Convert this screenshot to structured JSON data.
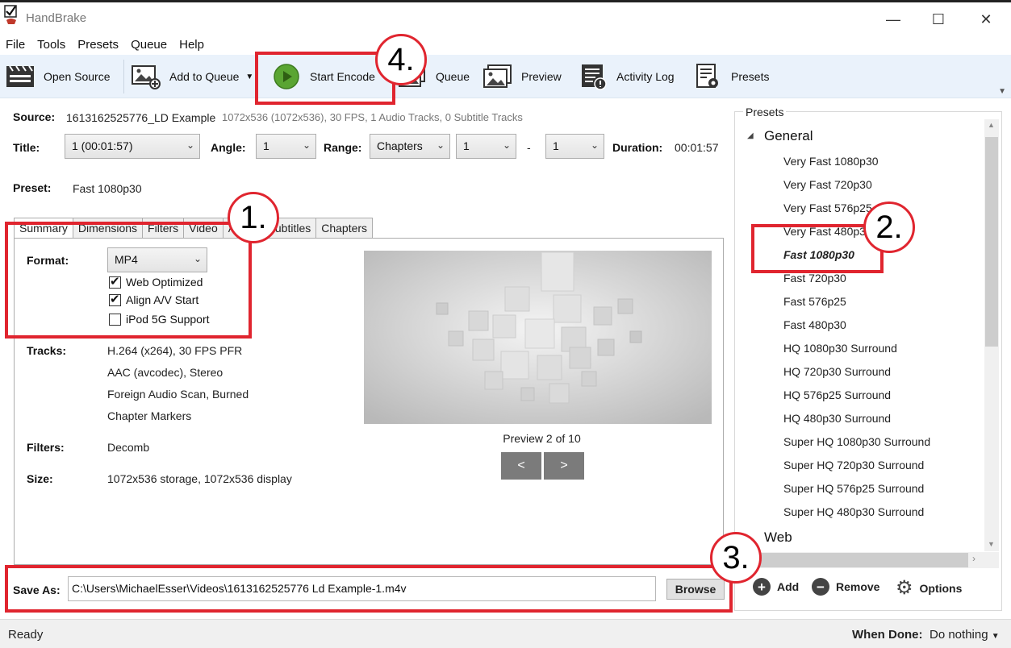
{
  "window": {
    "title": "HandBrake",
    "minimize": "—",
    "maximize": "☐",
    "close": "✕"
  },
  "menu": [
    "File",
    "Tools",
    "Presets",
    "Queue",
    "Help"
  ],
  "toolbar": {
    "open_source": "Open Source",
    "add_to_queue": "Add to Queue",
    "start_encode": "Start Encode",
    "queue": "Queue",
    "preview": "Preview",
    "activity_log": "Activity Log",
    "presets": "Presets"
  },
  "source": {
    "label": "Source:",
    "name": "1613162525776_LD Example",
    "info": "1072x536 (1072x536), 30 FPS, 1 Audio Tracks, 0 Subtitle Tracks"
  },
  "title_row": {
    "title_label": "Title:",
    "title_value": "1  (00:01:57)",
    "angle_label": "Angle:",
    "angle_value": "1",
    "range_label": "Range:",
    "range_type": "Chapters",
    "range_start": "1",
    "range_sep": "-",
    "range_end": "1",
    "duration_label": "Duration:",
    "duration_value": "00:01:57"
  },
  "preset_row": {
    "label": "Preset:",
    "value": "Fast 1080p30"
  },
  "tabs": [
    "Summary",
    "Dimensions",
    "Filters",
    "Video",
    "Audio",
    "Subtitles",
    "Chapters"
  ],
  "summary": {
    "format_label": "Format:",
    "format_value": "MP4",
    "web_optimized": "Web Optimized",
    "align_av": "Align A/V Start",
    "ipod": "iPod 5G Support",
    "tracks_label": "Tracks:",
    "tracks": [
      "H.264 (x264), 30 FPS PFR",
      "AAC (avcodec), Stereo",
      "Foreign Audio Scan, Burned",
      "Chapter Markers"
    ],
    "filters_label": "Filters:",
    "filters_value": "Decomb",
    "size_label": "Size:",
    "size_value": "1072x536 storage, 1072x536 display"
  },
  "preview": {
    "label": "Preview 2 of 10",
    "prev": "<",
    "next": ">"
  },
  "save_as": {
    "label": "Save As:",
    "path": "C:\\Users\\MichaelEsser\\Videos\\1613162525776 Ld Example-1.m4v",
    "browse": "Browse"
  },
  "presets_panel": {
    "title": "Presets",
    "category_general": "General",
    "category_web": "Web",
    "items": [
      "Very Fast 1080p30",
      "Very Fast 720p30",
      "Very Fast 576p25",
      "Very Fast 480p30",
      "Fast 1080p30",
      "Fast 720p30",
      "Fast 576p25",
      "Fast 480p30",
      "HQ 1080p30 Surround",
      "HQ 720p30 Surround",
      "HQ 576p25 Surround",
      "HQ 480p30 Surround",
      "Super HQ 1080p30 Surround",
      "Super HQ 720p30 Surround",
      "Super HQ 576p25 Surround",
      "Super HQ 480p30 Surround"
    ],
    "selected": "Fast 1080p30",
    "add": "Add",
    "remove": "Remove",
    "options": "Options"
  },
  "status": {
    "text": "Ready",
    "when_done_label": "When Done:",
    "when_done_value": "Do nothing"
  },
  "annotations": [
    "1.",
    "2.",
    "3.",
    "4."
  ],
  "colors": {
    "annotation": "#e0252f",
    "toolbar_bg": "#eaf2fb",
    "play_green": "#5aa532"
  }
}
